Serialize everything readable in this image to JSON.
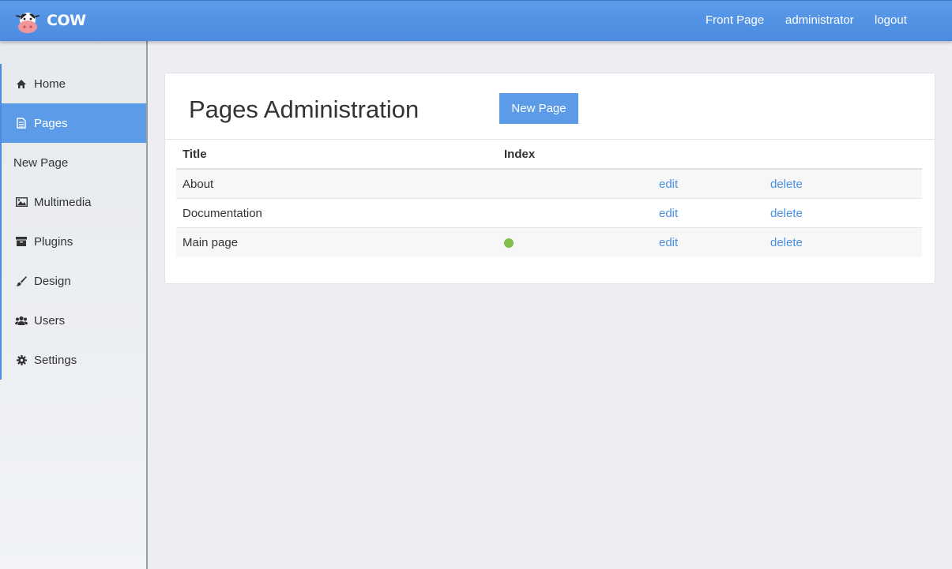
{
  "header": {
    "brand": "COW",
    "nav": [
      "Front Page",
      "administrator",
      "logout"
    ]
  },
  "sidebar": {
    "items": [
      {
        "label": "Home",
        "icon": "home-icon"
      },
      {
        "label": "Pages",
        "icon": "page-icon",
        "active": true
      },
      {
        "label": "New Page",
        "icon": ""
      },
      {
        "label": "Multimedia",
        "icon": "image-icon"
      },
      {
        "label": "Plugins",
        "icon": "archive-icon"
      },
      {
        "label": "Design",
        "icon": "brush-icon"
      },
      {
        "label": "Users",
        "icon": "users-icon"
      },
      {
        "label": "Settings",
        "icon": "gear-icon"
      }
    ]
  },
  "main": {
    "title": "Pages Administration",
    "new_button": "New Page",
    "columns": [
      "Title",
      "Index"
    ],
    "rows": [
      {
        "title": "About",
        "index": false,
        "edit": "edit",
        "delete": "delete"
      },
      {
        "title": "Documentation",
        "index": false,
        "edit": "edit",
        "delete": "delete"
      },
      {
        "title": "Main page",
        "index": true,
        "edit": "edit",
        "delete": "delete"
      }
    ]
  },
  "colors": {
    "accent": "#5b9be8",
    "link": "#4a8fe0",
    "index_dot": "#7ec04a"
  }
}
